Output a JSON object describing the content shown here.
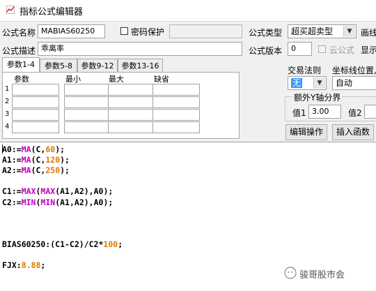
{
  "window": {
    "title": "指标公式编辑器"
  },
  "form": {
    "name_label": "公式名称",
    "name_value": "MABIAS60250",
    "password_label": "密码保护",
    "type_label": "公式类型",
    "type_value": "超买超卖型",
    "draw_label": "画线",
    "desc_label": "公式描述",
    "desc_value": "乖离率",
    "version_label": "公式版本",
    "version_value": "0",
    "cloud_label": "云公式",
    "display_label": "显示"
  },
  "tabs": [
    "参数1-4",
    "参数5-8",
    "参数9-12",
    "参数13-16"
  ],
  "params": {
    "headers": [
      "参数",
      "最小",
      "最大",
      "缺省"
    ],
    "rows": [
      "1",
      "2",
      "3",
      "4"
    ]
  },
  "trade": {
    "label": "交易法则",
    "value": "无"
  },
  "coord": {
    "label": "坐标线位置,",
    "value": "自动"
  },
  "extra_y": {
    "label": "额外Y轴分界",
    "v1_label": "值1",
    "v1_value": "3.00",
    "v2_label": "值2"
  },
  "buttons": {
    "edit": "编辑操作",
    "insert": "插入函数"
  },
  "editor": {
    "lines": [
      {
        "parts": [
          [
            "A0:=",
            ""
          ],
          [
            "MA",
            "fn"
          ],
          [
            "(C,",
            ""
          ],
          [
            "60",
            "num"
          ],
          [
            ");",
            ""
          ]
        ]
      },
      {
        "parts": [
          [
            "A1:=",
            ""
          ],
          [
            "MA",
            "fn"
          ],
          [
            "(C,",
            ""
          ],
          [
            "120",
            "num"
          ],
          [
            ");",
            ""
          ]
        ]
      },
      {
        "parts": [
          [
            "A2:=",
            ""
          ],
          [
            "MA",
            "fn"
          ],
          [
            "(C,",
            ""
          ],
          [
            "250",
            "num"
          ],
          [
            ");",
            ""
          ]
        ]
      },
      {
        "parts": [
          [
            "",
            ""
          ]
        ]
      },
      {
        "parts": [
          [
            "C1:=",
            ""
          ],
          [
            "MAX",
            "fn"
          ],
          [
            "(",
            ""
          ],
          [
            "MAX",
            "fn"
          ],
          [
            "(A1,A2),A0);",
            ""
          ]
        ]
      },
      {
        "parts": [
          [
            "C2:=",
            ""
          ],
          [
            "MIN",
            "fn"
          ],
          [
            "(",
            ""
          ],
          [
            "MIN",
            "fn"
          ],
          [
            "(A1,A2),A0);",
            ""
          ]
        ]
      },
      {
        "parts": [
          [
            "",
            ""
          ]
        ]
      },
      {
        "parts": [
          [
            "",
            ""
          ]
        ]
      },
      {
        "parts": [
          [
            "",
            ""
          ]
        ]
      },
      {
        "parts": [
          [
            "BIAS60250:(C1-C2)/C2*",
            ""
          ],
          [
            "100",
            "num"
          ],
          [
            ";",
            ""
          ]
        ]
      },
      {
        "parts": [
          [
            "",
            ""
          ]
        ]
      },
      {
        "parts": [
          [
            "FJX:",
            ""
          ],
          [
            "8.88",
            "num"
          ],
          [
            ";",
            ""
          ]
        ]
      }
    ]
  },
  "watermark": {
    "text": "骏哥股市会"
  },
  "colors": {
    "function": "#c000c0",
    "number": "#e07800",
    "selection": "#3399ff"
  }
}
